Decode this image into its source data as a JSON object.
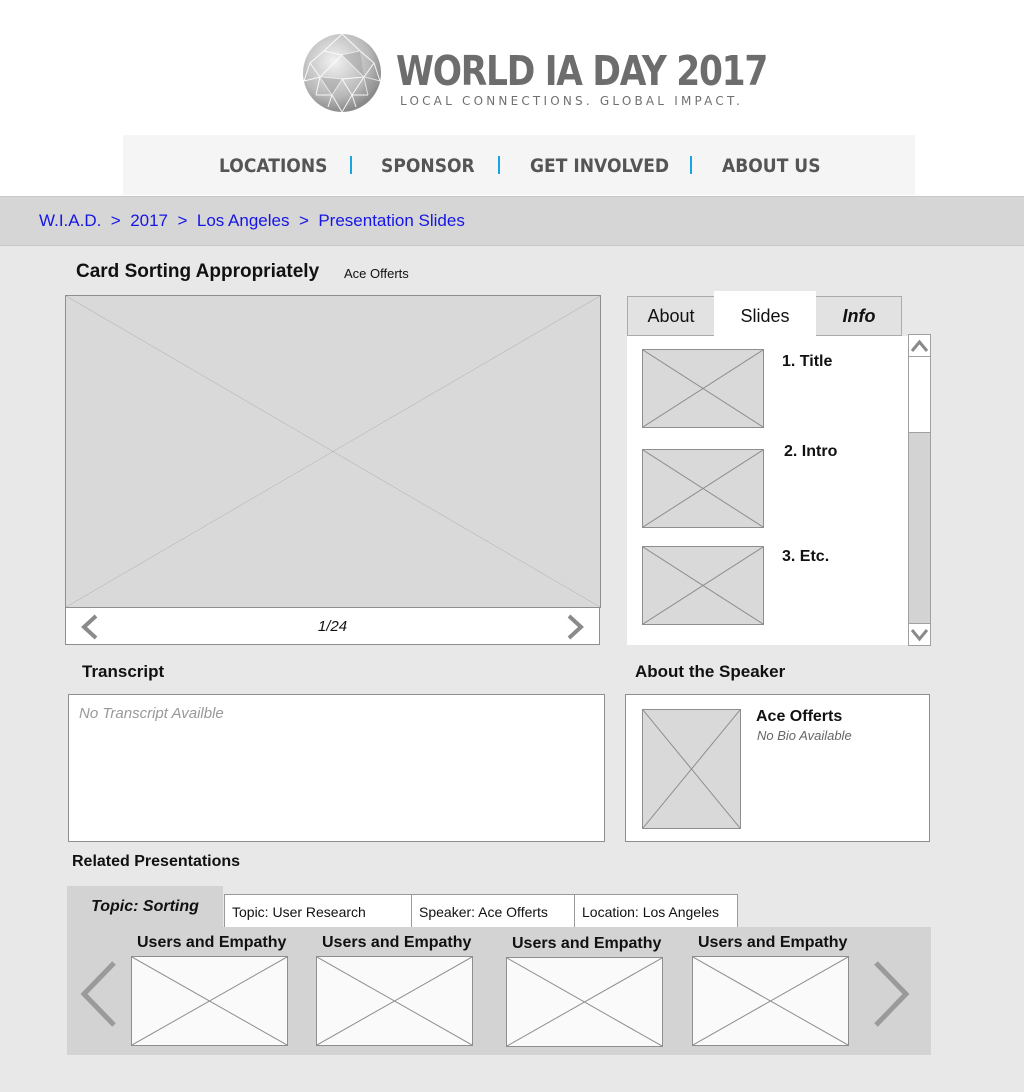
{
  "logo": {
    "title": "WORLD IA DAY 2017",
    "tagline": "LOCAL CONNECTIONS. GLOBAL IMPACT."
  },
  "nav": {
    "items": [
      {
        "label": "LOCATIONS"
      },
      {
        "label": "SPONSOR"
      },
      {
        "label": "GET INVOLVED"
      },
      {
        "label": "ABOUT US"
      }
    ],
    "separator_color": "#1aa3e0"
  },
  "breadcrumb": {
    "items": [
      "W.I.A.D.",
      "2017",
      "Los Angeles",
      "Presentation Slides"
    ],
    "separator": ">",
    "link_color": "#1515e6"
  },
  "presentation": {
    "title": "Card Sorting Appropriately",
    "author": "Ace Offerts",
    "slide_counter": "1/24"
  },
  "tabs": {
    "items": [
      "About",
      "Slides",
      "Info"
    ],
    "active": "Slides"
  },
  "slide_list": {
    "items": [
      {
        "label": "1. Title"
      },
      {
        "label": "2. Intro"
      },
      {
        "label": "3. Etc."
      }
    ]
  },
  "transcript": {
    "heading": "Transcript",
    "placeholder": "No Transcript Availble"
  },
  "speaker": {
    "heading": "About the Speaker",
    "name": "Ace Offerts",
    "bio": "No Bio Available"
  },
  "related": {
    "heading": "Related Presentations",
    "tabs": [
      {
        "label": "Topic: Sorting",
        "active": true
      },
      {
        "label": "Topic: User Research"
      },
      {
        "label": "Speaker: Ace Offerts"
      },
      {
        "label": "Location: Los Angeles"
      }
    ],
    "cards": [
      {
        "title": "Users and Empathy"
      },
      {
        "title": "Users and Empathy"
      },
      {
        "title": "Users and Empathy"
      },
      {
        "title": "Users and Empathy"
      }
    ]
  }
}
